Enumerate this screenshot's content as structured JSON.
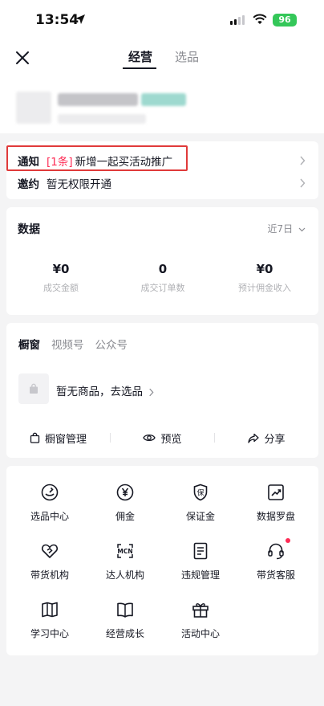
{
  "status_bar": {
    "time": "13:54",
    "battery": "96"
  },
  "nav": {
    "tabs": [
      {
        "label": "经营"
      },
      {
        "label": "选品"
      }
    ]
  },
  "notices": [
    {
      "key": "通知",
      "tag": "[1条]",
      "text": "新增一起买活动推广"
    },
    {
      "key": "邀约",
      "text": "暂无权限开通"
    }
  ],
  "data_section": {
    "title": "数据",
    "range": "近7日",
    "stats": [
      {
        "value": "¥0",
        "label": "成交金额"
      },
      {
        "value": "0",
        "label": "成交订单数"
      },
      {
        "value": "¥0",
        "label": "预计佣金收入"
      }
    ]
  },
  "showcase": {
    "tabs": [
      {
        "label": "橱窗"
      },
      {
        "label": "视频号"
      },
      {
        "label": "公众号"
      }
    ],
    "empty_text": "暂无商品，去选品",
    "actions": [
      {
        "label": "橱窗管理"
      },
      {
        "label": "预览"
      },
      {
        "label": "分享"
      }
    ]
  },
  "tools": [
    {
      "label": "选品中心",
      "icon": "product-center-icon"
    },
    {
      "label": "佣金",
      "icon": "yen-coin-icon"
    },
    {
      "label": "保证金",
      "icon": "deposit-shield-icon"
    },
    {
      "label": "数据罗盘",
      "icon": "chart-trend-icon"
    },
    {
      "label": "带货机构",
      "icon": "heart-handshake-icon"
    },
    {
      "label": "达人机构",
      "icon": "mcn-icon"
    },
    {
      "label": "违规管理",
      "icon": "document-icon"
    },
    {
      "label": "带货客服",
      "icon": "headset-icon",
      "badge": true
    },
    {
      "label": "学习中心",
      "icon": "book-open-icon"
    },
    {
      "label": "经营成长",
      "icon": "book-icon"
    },
    {
      "label": "活动中心",
      "icon": "gift-icon"
    }
  ],
  "colors": {
    "accent": "#fe2c55",
    "highlight": "#e03a3a",
    "battery": "#34c759"
  }
}
